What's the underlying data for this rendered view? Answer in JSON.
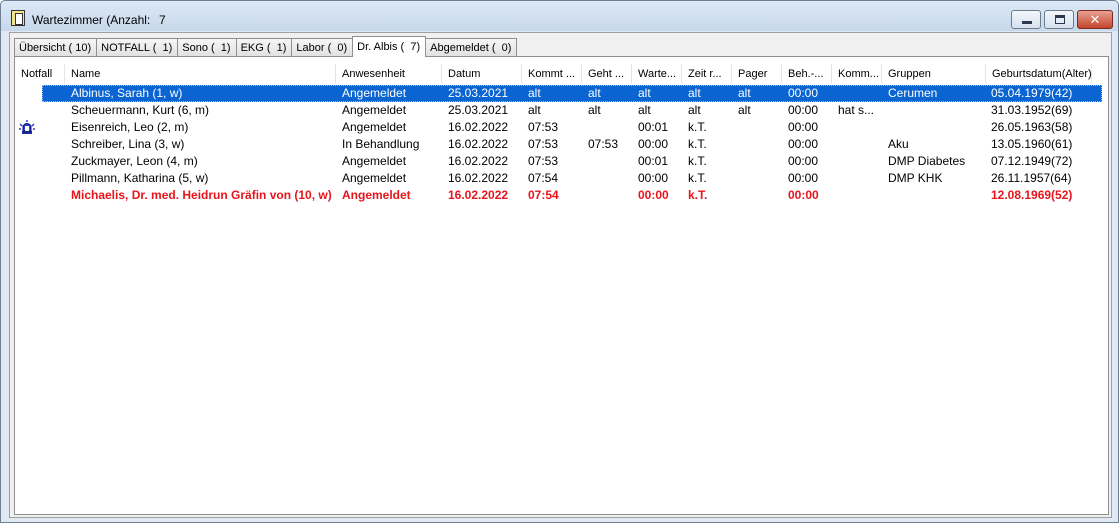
{
  "window": {
    "title": "Wartezimmer (Anzahl:",
    "count": "7",
    "colors": {
      "selection": "#0a64d2",
      "emergency_text": "#e8141b"
    }
  },
  "tabs": [
    {
      "label": "Übersicht ( 10)",
      "active": false
    },
    {
      "label": "NOTFALL (  1)",
      "active": false
    },
    {
      "label": "Sono (  1)",
      "active": false
    },
    {
      "label": "EKG (  1)",
      "active": false
    },
    {
      "label": "Labor (  0)",
      "active": false
    },
    {
      "label": "Dr. Albis (  7)",
      "active": true
    },
    {
      "label": "Abgemeldet (  0)",
      "active": false
    }
  ],
  "columns": [
    "Notfall",
    "Name",
    "Anwesenheit",
    "Datum",
    "Kommt ...",
    "Geht ...",
    "Warte...",
    "Zeit r...",
    "Pager",
    "Beh.-...",
    "Komm...",
    "Gruppen",
    "Geburtsdatum(Alter)"
  ],
  "rows": [
    {
      "emergency_icon": "",
      "name": "Albinus, Sarah  (1, w)",
      "presence": "Angemeldet",
      "date": "25.03.2021",
      "arrives": "alt",
      "leaves": "alt",
      "waiting": "alt",
      "time_r": "alt",
      "pager": "alt",
      "treatment": "00:00",
      "comment": "",
      "groups": "Cerumen",
      "birth": "05.04.1979(42)"
    },
    {
      "emergency_icon": "",
      "name": "Scheuermann, Kurt  (6, m)",
      "presence": "Angemeldet",
      "date": "25.03.2021",
      "arrives": "alt",
      "leaves": "alt",
      "waiting": "alt",
      "time_r": "alt",
      "pager": "alt",
      "treatment": "00:00",
      "comment": "hat s...",
      "groups": "",
      "birth": "31.03.1952(69)"
    },
    {
      "emergency_icon": "siren-icon",
      "name": "Eisenreich, Leo  (2, m)",
      "presence": "Angemeldet",
      "date": "16.02.2022",
      "arrives": "07:53",
      "leaves": "",
      "waiting": "00:01",
      "time_r": "k.T.",
      "pager": "",
      "treatment": "00:00",
      "comment": "",
      "groups": "",
      "birth": "26.05.1963(58)"
    },
    {
      "emergency_icon": "",
      "name": "Schreiber, Lina  (3, w)",
      "presence": "In Behandlung",
      "date": "16.02.2022",
      "arrives": "07:53",
      "leaves": "07:53",
      "waiting": "00:00",
      "time_r": "k.T.",
      "pager": "",
      "treatment": "00:00",
      "comment": "",
      "groups": "Aku",
      "birth": "13.05.1960(61)"
    },
    {
      "emergency_icon": "",
      "name": "Zuckmayer, Leon  (4, m)",
      "presence": "Angemeldet",
      "date": "16.02.2022",
      "arrives": "07:53",
      "leaves": "",
      "waiting": "00:01",
      "time_r": "k.T.",
      "pager": "",
      "treatment": "00:00",
      "comment": "",
      "groups": "DMP Diabetes",
      "birth": "07.12.1949(72)"
    },
    {
      "emergency_icon": "",
      "name": "Pillmann, Katharina  (5, w)",
      "presence": "Angemeldet",
      "date": "16.02.2022",
      "arrives": "07:54",
      "leaves": "",
      "waiting": "00:00",
      "time_r": "k.T.",
      "pager": "",
      "treatment": "00:00",
      "comment": "",
      "groups": "DMP KHK",
      "birth": "26.11.1957(64)"
    },
    {
      "emergency_icon": "",
      "name": "Michaelis, Dr. med. Heidrun Gräfin von (10, w)",
      "presence": "Angemeldet",
      "date": "16.02.2022",
      "arrives": "07:54",
      "leaves": "",
      "waiting": "00:00",
      "time_r": "k.T.",
      "pager": "",
      "treatment": "00:00",
      "comment": "",
      "groups": "",
      "birth": "12.08.1969(52)"
    }
  ]
}
